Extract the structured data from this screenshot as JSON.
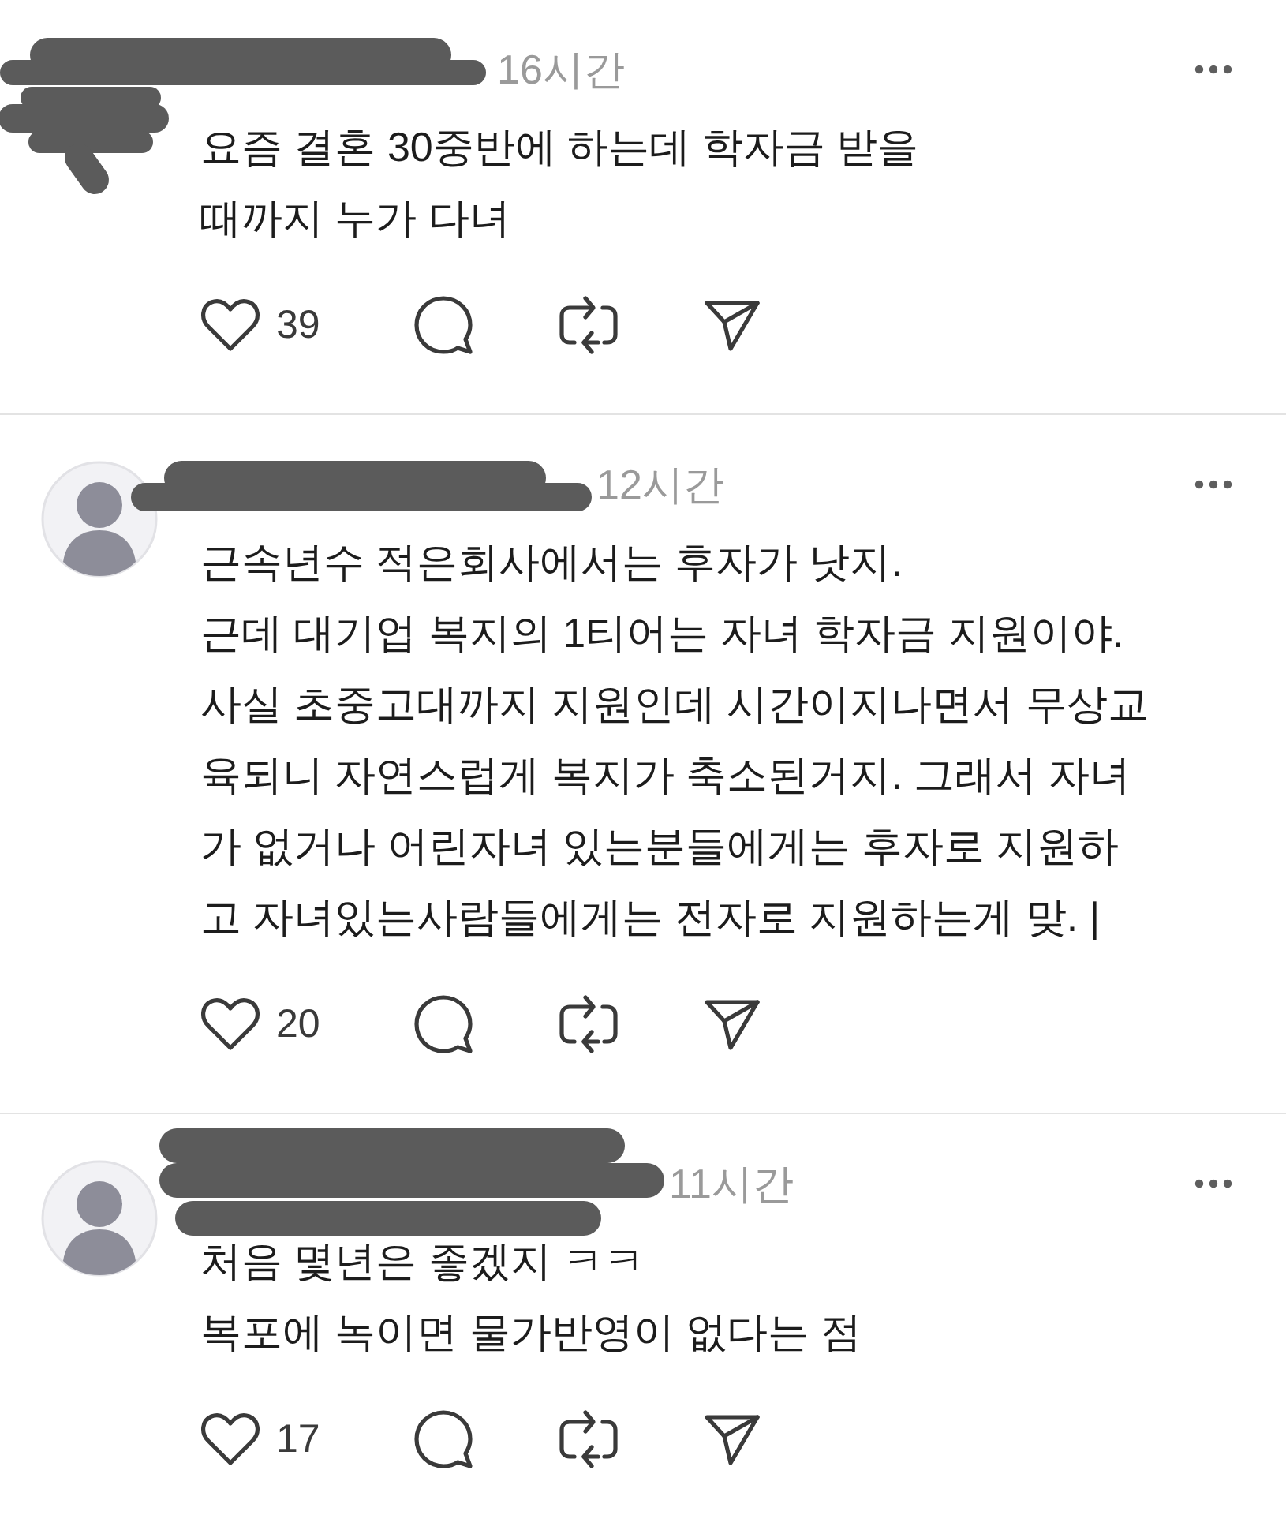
{
  "comments": [
    {
      "avatar": false,
      "username_redacted": true,
      "time": "16시간",
      "body": [
        "요즘 결혼 30중반에 하는데 학자금 받을",
        "때까지 누가 다녀"
      ],
      "likes": "39"
    },
    {
      "avatar": true,
      "username_redacted": true,
      "time": "12시간",
      "body": [
        "근속년수 적은회사에서는 후자가 낫지.",
        "근데 대기업 복지의 1티어는 자녀 학자금 지원이야.",
        "사실 초중고대까지 지원인데 시간이지나면서 무상교",
        "육되니 자연스럽게 복지가 축소된거지. 그래서 자녀",
        "가 없거나 어린자녀 있는분들에게는 후자로 지원하",
        "고 자녀있는사람들에게는 전자로 지원하는게 맞. |"
      ],
      "likes": "20"
    },
    {
      "avatar": true,
      "username_redacted": true,
      "time": "11시간",
      "body": [
        "처음 몇년은 좋겠지 ㅋㅋ",
        "복포에 녹이면 물가반영이 없다는 점"
      ],
      "likes": "17"
    }
  ]
}
